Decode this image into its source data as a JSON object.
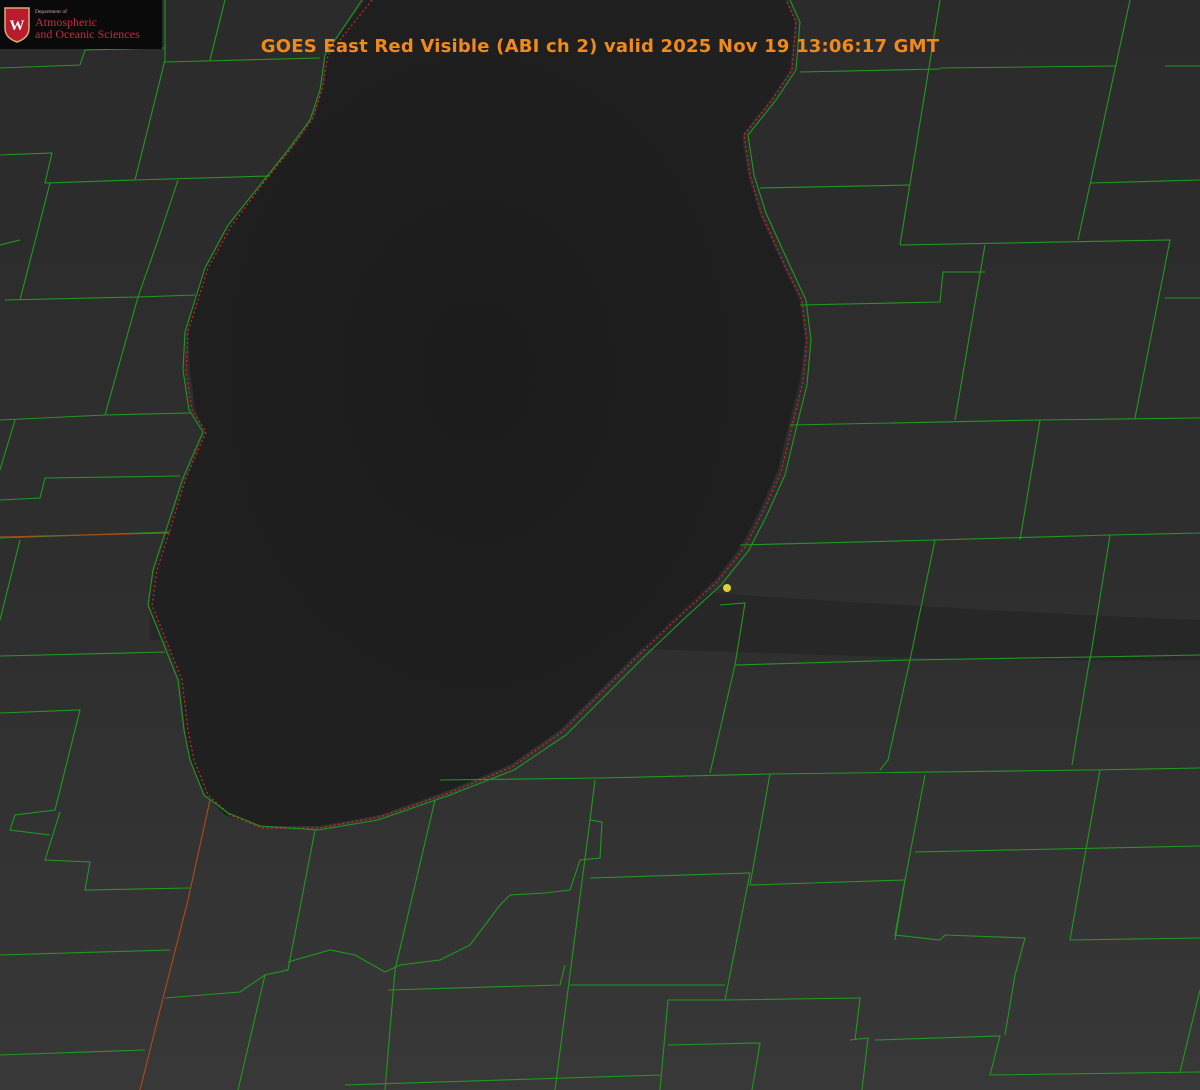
{
  "title": "GOES East Red Visible (ABI ch 2) valid 2025 Nov 19 13:06:17 GMT",
  "logo": {
    "department": "Department of",
    "line1": "Atmospheric",
    "line2": "and Oceanic Sciences",
    "emblem": "W"
  },
  "colors": {
    "title": "#f08a1c",
    "county_lines": "#1f9a1f",
    "state_line": "#b04a1c",
    "shoreline_dotted": "#d02828",
    "marker": "#e0d030",
    "land": "#2e2e2e",
    "lake": "#1e1e1e"
  },
  "icons": {
    "logo": "uw-crest-icon",
    "marker": "location-dot-icon"
  }
}
